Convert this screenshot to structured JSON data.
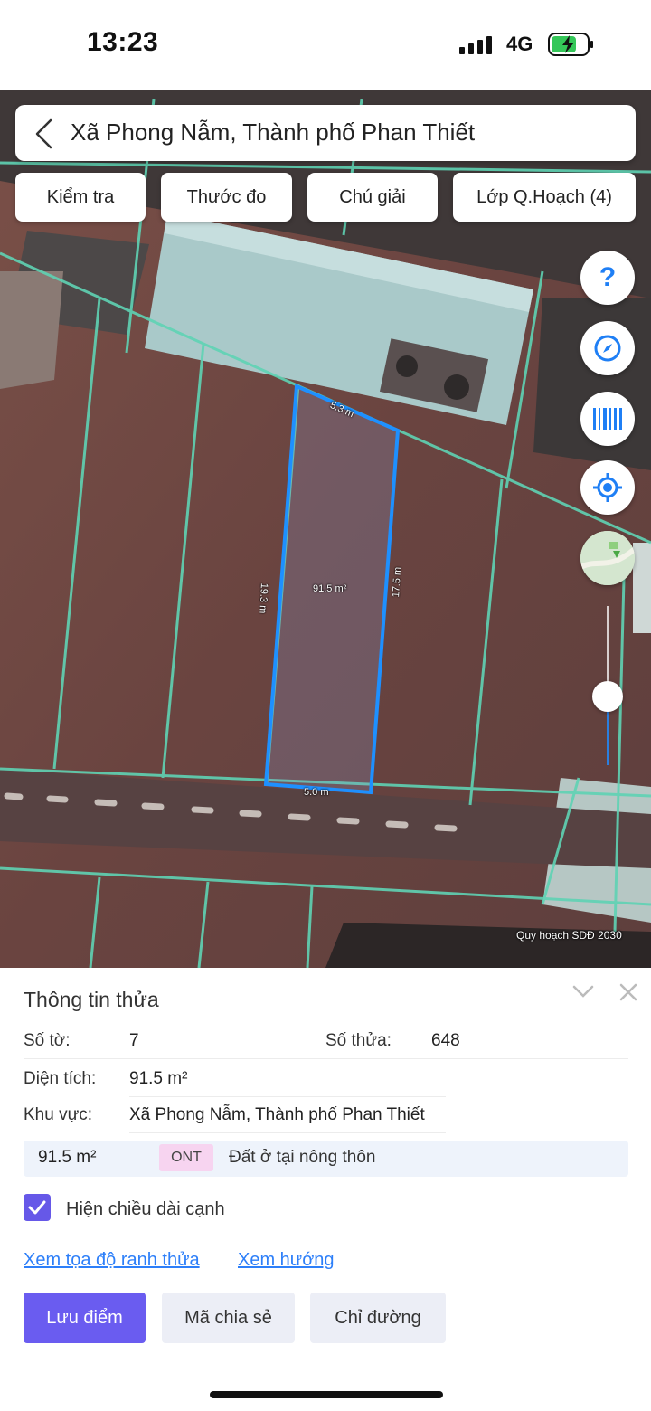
{
  "status_bar": {
    "time": "13:23",
    "network": "4G"
  },
  "header": {
    "location_title": "Xã Phong Nẫm, Thành phố Phan Thiết"
  },
  "toolbar": {
    "check_label": "Kiểm tra",
    "ruler_label": "Thước đo",
    "legend_label": "Chú giải",
    "layers_label": "Lớp Q.Hoạch (4)"
  },
  "map": {
    "edge_top": "5.3 m",
    "edge_left": "19.3 m",
    "edge_right": "17.5 m",
    "edge_bottom": "5.0 m",
    "parcel_area": "91.5 m²",
    "layer_caption": "Quy hoạch SDĐ 2030",
    "zoom_level": 0.4,
    "colors": {
      "parcel_outline": "#1e90ff",
      "parcel_grid": "#5fd3b4"
    }
  },
  "side_controls": [
    "help-icon",
    "compass-icon",
    "barcode-icon",
    "locate-icon",
    "map-thumbnail"
  ],
  "panel": {
    "title": "Thông tin thửa",
    "sheet_label": "Số tờ:",
    "sheet_value": "7",
    "parcel_label": "Số thửa:",
    "parcel_value": "648",
    "area_label": "Diện tích:",
    "area_value": "91.5 m²",
    "region_label": "Khu vực:",
    "region_value": "Xã Phong Nẫm, Thành phố Phan Thiết",
    "land_use": {
      "area": "91.5 m²",
      "code": "ONT",
      "description": "Đất ở tại nông thôn"
    },
    "show_edge_length_label": "Hiện chiều dài cạnh",
    "show_edge_length_checked": true,
    "link_boundary": "Xem tọa độ ranh thửa",
    "link_direction": "Xem hướng",
    "save_label": "Lưu điểm",
    "share_label": "Mã chia sẻ",
    "directions_label": "Chỉ đường"
  }
}
